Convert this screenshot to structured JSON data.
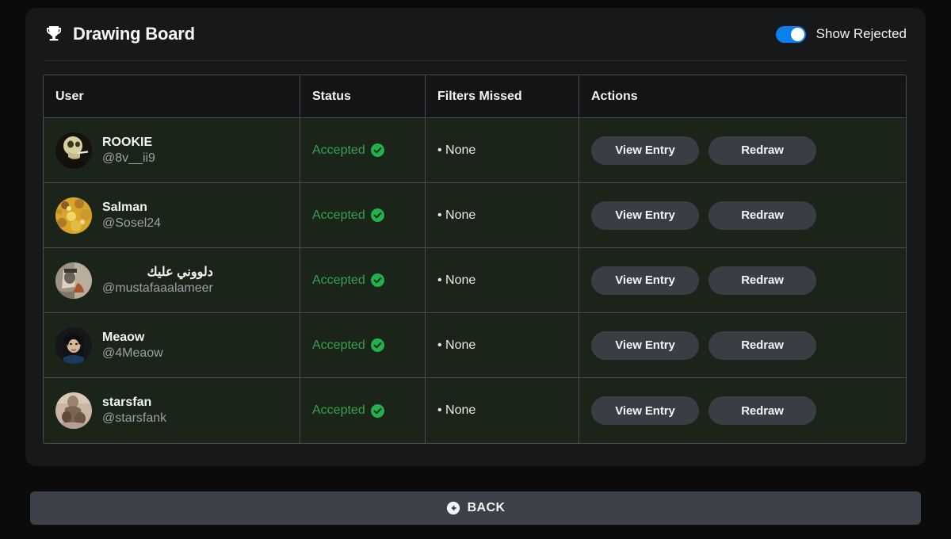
{
  "header": {
    "title": "Drawing Board",
    "trophy_icon": "trophy-icon",
    "toggle_label": "Show Rejected",
    "toggle_on": true,
    "toggle_accent": "#0b7fee"
  },
  "table": {
    "columns": [
      "User",
      "Status",
      "Filters Missed",
      "Actions"
    ],
    "rows": [
      {
        "name": "ROOKIE",
        "handle": "@8v__ii9",
        "rtl": false,
        "status": "Accepted",
        "status_color": "#38a14e",
        "status_icon": "check-circle-icon",
        "filters_missed": "• None",
        "actions": [
          "View Entry",
          "Redraw"
        ],
        "avatar": "skull-painting-avatar"
      },
      {
        "name": "Salman",
        "handle": "@Sosel24",
        "rtl": false,
        "status": "Accepted",
        "status_color": "#38a14e",
        "status_icon": "check-circle-icon",
        "filters_missed": "• None",
        "actions": [
          "View Entry",
          "Redraw"
        ],
        "avatar": "golden-texture-avatar"
      },
      {
        "name": "دلووني عليك",
        "handle": "@mustafaaalameer",
        "rtl": true,
        "status": "Accepted",
        "status_color": "#38a14e",
        "status_icon": "check-circle-icon",
        "filters_missed": "• None",
        "actions": [
          "View Entry",
          "Redraw"
        ],
        "avatar": "portrait-sepia-avatar"
      },
      {
        "name": "Meaow",
        "handle": "@4Meaow",
        "rtl": false,
        "status": "Accepted",
        "status_color": "#38a14e",
        "status_icon": "check-circle-icon",
        "filters_missed": "• None",
        "actions": [
          "View Entry",
          "Redraw"
        ],
        "avatar": "dark-hair-portrait-avatar"
      },
      {
        "name": "starsfan",
        "handle": "@starsfank",
        "rtl": false,
        "status": "Accepted",
        "status_color": "#38a14e",
        "status_icon": "check-circle-icon",
        "filters_missed": "• None",
        "actions": [
          "View Entry",
          "Redraw"
        ],
        "avatar": "vintage-photo-avatar"
      }
    ]
  },
  "footer": {
    "back_label": "BACK",
    "back_icon": "arrow-circle-left-icon"
  }
}
